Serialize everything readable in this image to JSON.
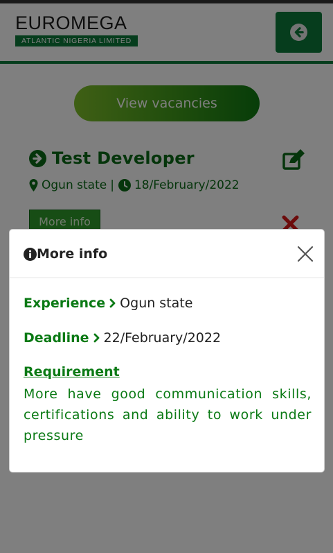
{
  "header": {
    "logo_main": "EUROMEGA",
    "logo_sub": "ATLANTIC NIGERIA LIMITED",
    "back_icon": "arrow-circle-left-icon"
  },
  "colors": {
    "brand_green": "#0c7a3a",
    "text_green": "#0b7a15"
  },
  "vacancies_button": {
    "label": "View vacancies"
  },
  "job": {
    "title": "Test Developer",
    "location": "Ogun state",
    "separator": "|",
    "date": "18/February/2022",
    "more_info_label": "More info"
  },
  "modal": {
    "title": "More info",
    "experience_label": "Experience",
    "experience_value": "Ogun state",
    "deadline_label": "Deadline",
    "deadline_value": "22/February/2022",
    "requirement_label": "Requirement",
    "requirement_text": "More have good communication skills, certifications and ability to work under pressure"
  }
}
